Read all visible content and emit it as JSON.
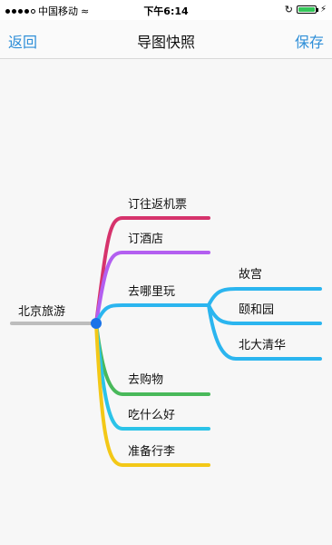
{
  "status": {
    "carrier": "中国移动",
    "time": "下午6:14"
  },
  "nav": {
    "back_label": "返回",
    "title": "导图快照",
    "save_label": "保存"
  },
  "mindmap": {
    "root": "北京旅游",
    "branches": [
      {
        "label": "订往返机票",
        "color": "#d6336c"
      },
      {
        "label": "订酒店",
        "color": "#b35ff0"
      },
      {
        "label": "去哪里玩",
        "color": "#2bb5ef",
        "children": [
          "故宫",
          "颐和园",
          "北大清华"
        ]
      },
      {
        "label": "去购物",
        "color": "#49b95a"
      },
      {
        "label": "吃什么好",
        "color": "#2bc3e8"
      },
      {
        "label": "准备行李",
        "color": "#f3c817"
      }
    ],
    "root_color": "#bdbdbd",
    "hub_color": "#1a73e8"
  }
}
